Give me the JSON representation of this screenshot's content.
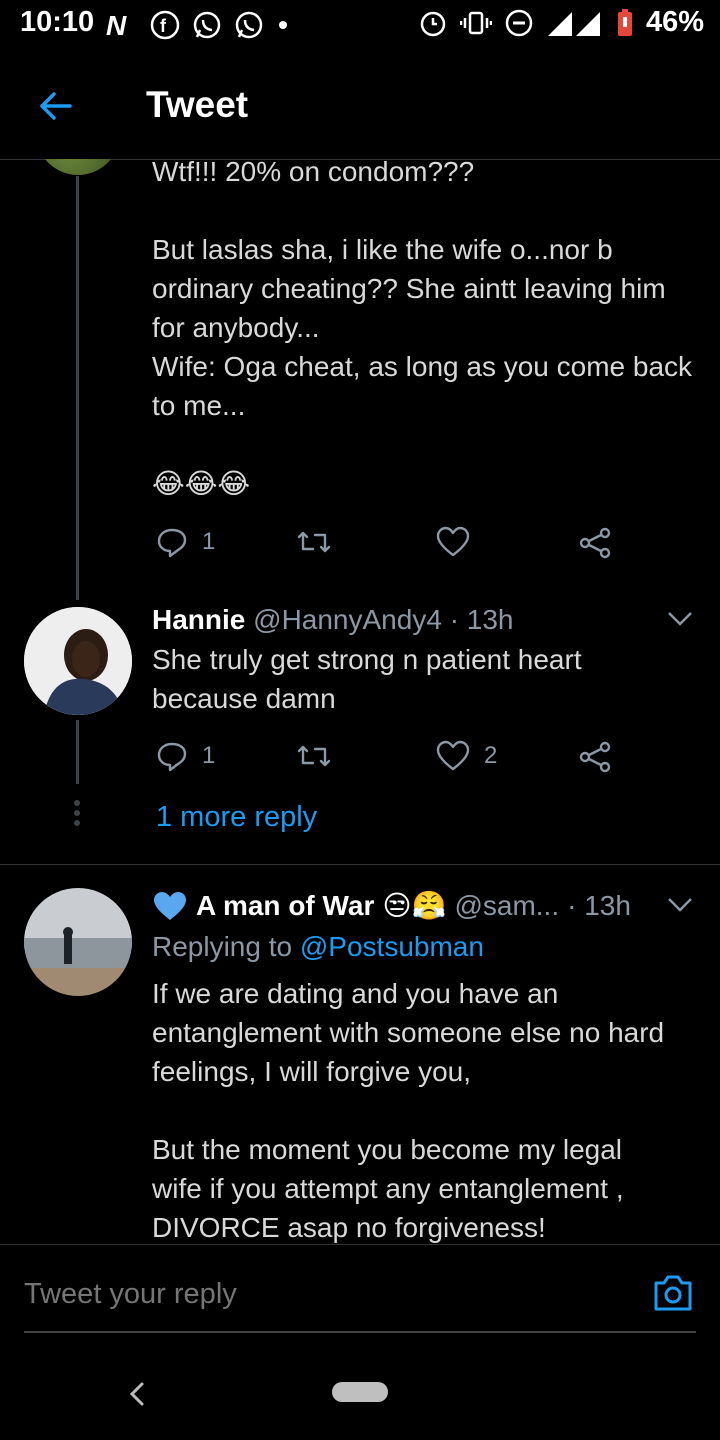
{
  "status_bar": {
    "time": "10:10",
    "battery": "46%",
    "network": "3G"
  },
  "header": {
    "title": "Tweet"
  },
  "tweet1": {
    "text": "Wtf!!! 20% on condom???\n\nBut laslas sha, i like the wife o...nor b ordinary cheating?? She aintt leaving him for anybody...\nWife: Oga cheat, as long as you come back to me...\n\n😂😂😂",
    "reply_count": "1"
  },
  "tweet2": {
    "name": "Hannie",
    "handle": "@HannyAndy4",
    "time": "· 13h",
    "text": "She truly get strong n patient heart because damn",
    "reply_count": "1",
    "like_count": "2",
    "more_replies": "1 more reply"
  },
  "tweet3": {
    "name_prefix_icon": "blue-heart",
    "name": "A man of War",
    "name_emoji": "😒😤",
    "handle": "@sam...",
    "time": "· 13h",
    "replying_label": "Replying to",
    "replying_to": "@Postsubman",
    "text": "If we are dating and you have an entanglement with someone else no hard feelings, I will forgive you,\n\nBut the moment you become my legal wife if you attempt any entanglement , DIVORCE asap no forgiveness!"
  },
  "reply": {
    "placeholder": "Tweet your reply"
  },
  "colors": {
    "accent": "#1d9bf0",
    "muted": "#8b98a5",
    "background": "#000000"
  }
}
